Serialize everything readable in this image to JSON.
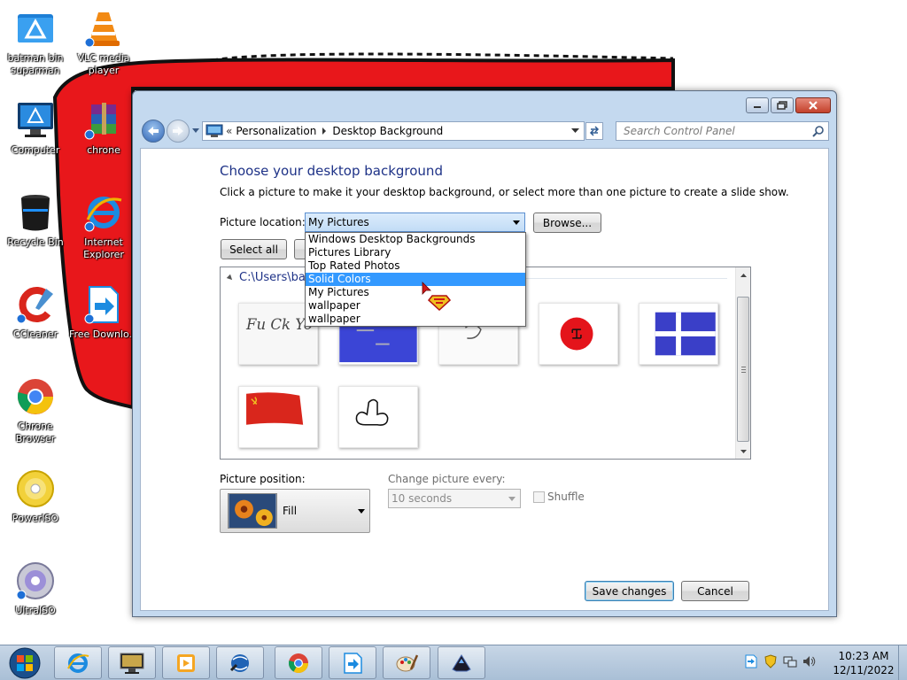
{
  "desktop": {
    "icons": [
      {
        "label": "batman bin suparman",
        "icon": "folder-icon"
      },
      {
        "label": "VLC media player",
        "icon": "vlc-icon"
      },
      {
        "label": "Computer",
        "icon": "computer-icon"
      },
      {
        "label": "chrone",
        "icon": "winrar-icon"
      },
      {
        "label": "Recycle Bin",
        "icon": "recycle-bin-icon"
      },
      {
        "label": "Internet Explorer",
        "icon": "internet-explorer-icon"
      },
      {
        "label": "CCleaner",
        "icon": "ccleaner-icon"
      },
      {
        "label": "Free Downlo...",
        "icon": "free-download-manager-icon"
      },
      {
        "label": "Chrone Browser",
        "icon": "chrome-icon"
      },
      {
        "label": "PowerISO",
        "icon": "poweriso-icon"
      },
      {
        "label": "UltraISO",
        "icon": "ultraiso-icon"
      }
    ]
  },
  "window": {
    "address": {
      "chevron": "«",
      "crumbs": [
        "Personalization",
        "Desktop Background"
      ]
    },
    "search": {
      "placeholder": "Search Control Panel"
    },
    "heading": "Choose your desktop background",
    "subtext": "Click a picture to make it your desktop background, or select more than one picture to create a slide show.",
    "picture_location": {
      "label": "Picture location:",
      "value": "My Pictures",
      "options": [
        "Windows Desktop Backgrounds",
        "Pictures Library",
        "Top Rated Photos",
        "Solid Colors",
        "My Pictures",
        "wallpaper",
        "wallpaper"
      ],
      "highlighted": "Solid Colors"
    },
    "browse_label": "Browse...",
    "select_all_label": "Select all",
    "folder_path": "C:\\Users\\ba",
    "picture_position": {
      "label": "Picture position:",
      "value": "Fill"
    },
    "change_every": {
      "label": "Change picture every:",
      "value": "10 seconds"
    },
    "shuffle_label": "Shuffle",
    "save_label": "Save changes",
    "cancel_label": "Cancel",
    "thumbnails": [
      {
        "name": "thumb-handwriting",
        "text": "Fu Ck Yo u"
      },
      {
        "name": "thumb-blue-screen"
      },
      {
        "name": "thumb-sketch"
      },
      {
        "name": "thumb-red-circle"
      },
      {
        "name": "thumb-blue-cross"
      },
      {
        "name": "thumb-red-flag"
      },
      {
        "name": "thumb-doodle"
      }
    ]
  },
  "taskbar": {
    "pinned": [
      "internet-explorer-icon",
      "monitor-app-icon",
      "media-player-icon",
      "globe-app-icon",
      "chrome-icon",
      "free-download-manager-icon",
      "paint-icon",
      "alienware-icon"
    ],
    "clock": {
      "time": "10:23 AM",
      "date": "12/11/2022"
    }
  },
  "colors": {
    "accent": "#1e3287",
    "selection": "#3399ff",
    "wallpaper_red": "#e8171b"
  }
}
